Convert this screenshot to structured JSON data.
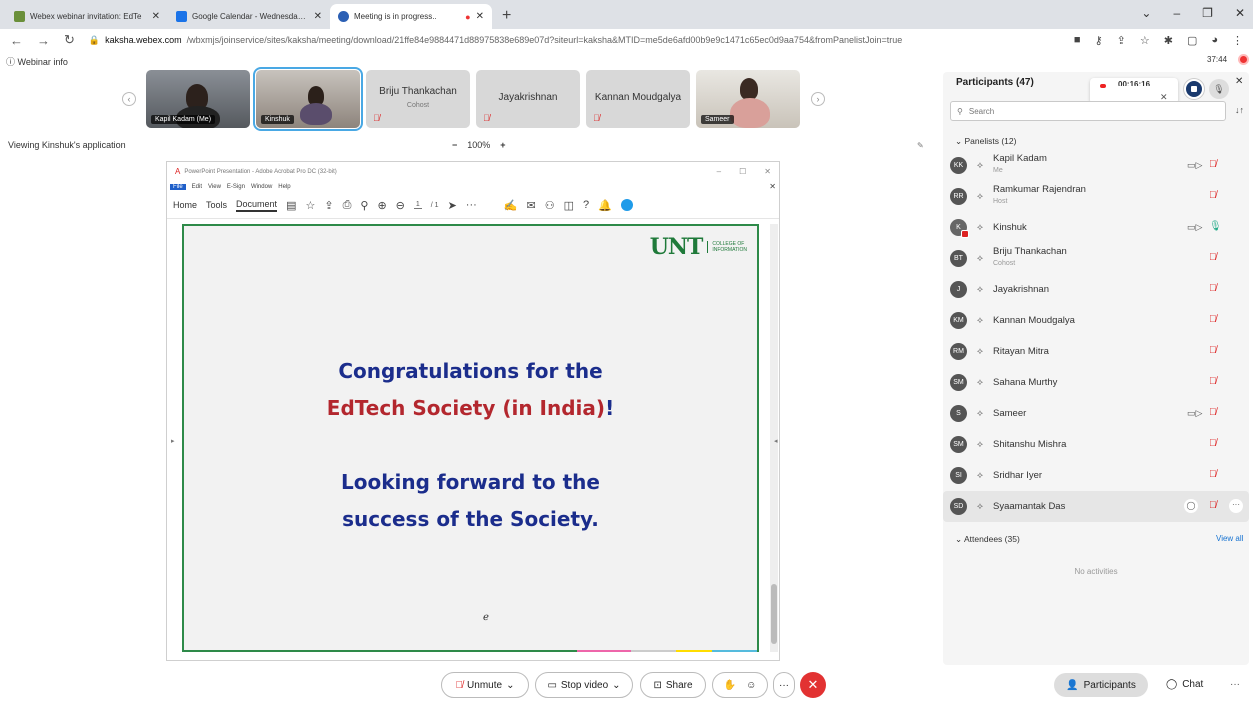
{
  "browser": {
    "tabs": [
      {
        "title": "Webex webinar invitation: EdTe",
        "color": "#6a8f3a",
        "active": false
      },
      {
        "title": "Google Calendar - Wednesday, A",
        "color": "#1a73e8",
        "active": false
      },
      {
        "title": "Meeting is in progress..",
        "color": "#2b5fb4",
        "active": true
      }
    ],
    "new_tab": "+",
    "url_host": "kaksha.webex.com",
    "url_rest": "/wbxmjs/joinservice/sites/kaksha/meeting/download/21ffe84e9884471d88975838e689e07d?siteurl=kaksha&MTID=me5de6afd00b9e9c1471c65ec0d9aa754&fromPanelistJoin=true"
  },
  "header": {
    "webinar_info": "Webinar info",
    "timer": "37:44"
  },
  "video_strip": [
    {
      "name": "Kapil Kadam (Me)",
      "type": "video"
    },
    {
      "name": "Kinshuk",
      "type": "video",
      "active": true
    },
    {
      "name": "Briju Thankachan",
      "sub": "Cohost",
      "type": "name"
    },
    {
      "name": "Jayakrishnan",
      "type": "name"
    },
    {
      "name": "Kannan Moudgalya",
      "type": "name"
    },
    {
      "name": "Sameer",
      "type": "video"
    }
  ],
  "viewing": {
    "label": "Viewing Kinshuk's application",
    "minus": "−",
    "zoom": "100%",
    "plus": "+"
  },
  "shared_app": {
    "title": "PowerPoint Presentation - Adobe Acrobat Pro DC (32-bit)",
    "menu": [
      "File",
      "Edit",
      "View",
      "E-Sign",
      "Window",
      "Help"
    ],
    "toolbar_tabs": [
      "Home",
      "Tools",
      "Document"
    ],
    "page": "1",
    "page_total": "/ 1"
  },
  "slide": {
    "logo": "UNT",
    "logo_sub1": "COLLEGE OF",
    "logo_sub2": "INFORMATION",
    "line1": "Congratulations for the",
    "line2_red": "EdTech Society (in India)",
    "line2_end": "!",
    "line3": "Looking forward to the",
    "line4": "success of the Society."
  },
  "panel": {
    "title": "Participants (47)",
    "search_placeholder": "Search",
    "panelists_label": "Panelists (12)",
    "attendees_label": "Attendees (35)",
    "view_all": "View all",
    "no_activities": "No activities",
    "panelists": [
      {
        "initials": "KK",
        "name": "Kapil Kadam",
        "sub": "Me",
        "cam": true,
        "mic": "muted"
      },
      {
        "initials": "RR",
        "name": "Ramkumar Rajendran",
        "sub": "Host",
        "cam": false,
        "mic": "muted"
      },
      {
        "initials": "K",
        "name": "Kinshuk",
        "sub": "",
        "cam": true,
        "mic": "on"
      },
      {
        "initials": "BT",
        "name": "Briju Thankachan",
        "sub": "Cohost",
        "cam": false,
        "mic": "muted"
      },
      {
        "initials": "J",
        "name": "Jayakrishnan",
        "sub": "",
        "cam": false,
        "mic": "muted"
      },
      {
        "initials": "KM",
        "name": "Kannan Moudgalya",
        "sub": "",
        "cam": false,
        "mic": "muted"
      },
      {
        "initials": "RM",
        "name": "Ritayan Mitra",
        "sub": "",
        "cam": false,
        "mic": "muted"
      },
      {
        "initials": "SM",
        "name": "Sahana Murthy",
        "sub": "",
        "cam": false,
        "mic": "muted"
      },
      {
        "initials": "S",
        "name": "Sameer",
        "sub": "",
        "cam": true,
        "mic": "muted"
      },
      {
        "initials": "SM",
        "name": "Shitanshu Mishra",
        "sub": "",
        "cam": false,
        "mic": "muted"
      },
      {
        "initials": "SI",
        "name": "Sridhar Iyer",
        "sub": "",
        "cam": false,
        "mic": "muted"
      },
      {
        "initials": "SD",
        "name": "Syaamantak Das",
        "sub": "",
        "cam": false,
        "mic": "muted",
        "highlight": true
      }
    ]
  },
  "controls": {
    "unmute": "Unmute",
    "stop_video": "Stop video",
    "share": "Share",
    "participants": "Participants",
    "chat": "Chat",
    "more": "···"
  }
}
